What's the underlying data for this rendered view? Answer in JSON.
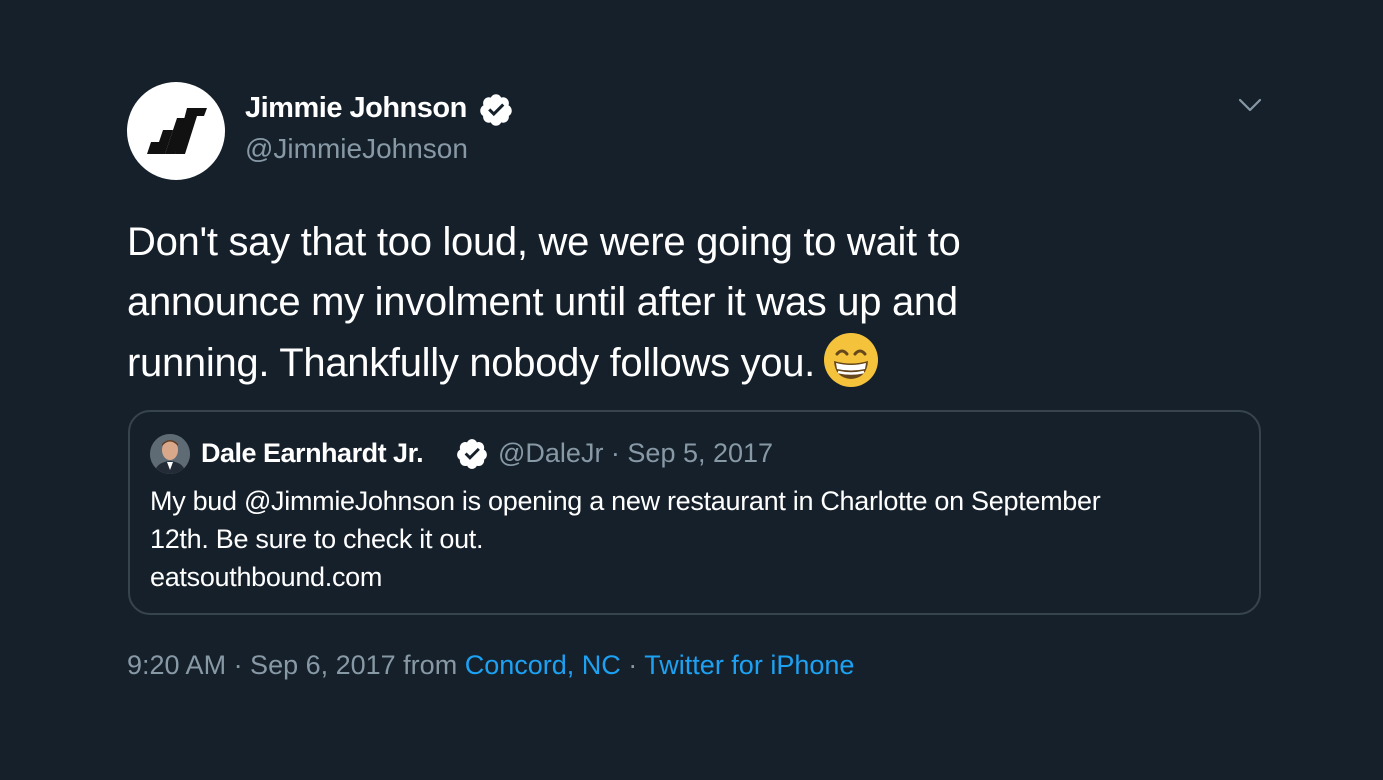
{
  "author": {
    "name": "Jimmie Johnson",
    "handle": "@JimmieJohnson",
    "verified_icon": "verified-badge-icon",
    "avatar_icon": "jimmie-johnson-logo-icon"
  },
  "tweet": {
    "lines": [
      "Don't say that too loud, we were going to wait to",
      "announce my involment until after it was up and",
      "running. Thankfully nobody follows you."
    ],
    "emoji_icon": "grinning-face-emoji-icon"
  },
  "quoted_tweet": {
    "name": "Dale Earnhardt Jr.",
    "handle_date": "@DaleJr · Sep 5, 2017",
    "lines": [
      "My bud @JimmieJohnson is opening a new restaurant in Charlotte on September",
      "12th. Be sure to check it out.",
      "eatsouthbound.com"
    ]
  },
  "meta": {
    "time_date": "9:20 AM · Sep 6, 2017 from",
    "location": "Concord, NC",
    "separator": "·",
    "source": "Twitter for iPhone"
  },
  "colors": {
    "background": "#15202b",
    "text_primary": "#ffffff",
    "text_secondary": "#8899a6",
    "link": "#1da1f2",
    "border": "#38444d"
  }
}
